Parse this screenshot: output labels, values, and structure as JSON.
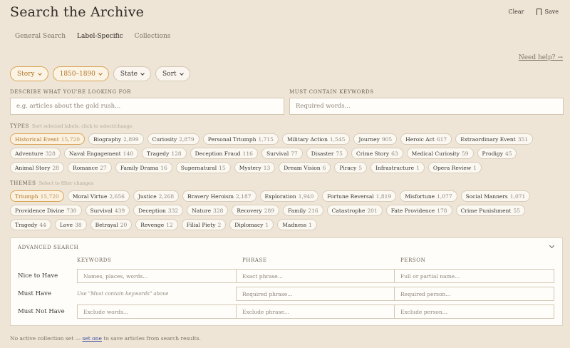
{
  "header": {
    "title": "Search the Archive",
    "clear_label": "Clear",
    "save_label": "Save"
  },
  "tabs": [
    {
      "label": "General Search",
      "active": false
    },
    {
      "label": "Label-Specific",
      "active": true
    },
    {
      "label": "Collections",
      "active": false
    }
  ],
  "help_link": "Need help? →",
  "filters": [
    {
      "label": "Story",
      "selected": true
    },
    {
      "label": "1850–1890",
      "selected": true
    },
    {
      "label": "State",
      "selected": false
    },
    {
      "label": "Sort",
      "selected": false
    }
  ],
  "describe": {
    "label": "DESCRIBE WHAT YOU'RE LOOKING FOR",
    "placeholder": "e.g. articles about the gold rush..."
  },
  "keywords": {
    "label": "MUST CONTAIN KEYWORDS",
    "placeholder": "Required words..."
  },
  "types": {
    "label": "TYPES",
    "hint": "Sort selected labels: click to select/change",
    "items": [
      {
        "name": "Historical Event",
        "count": "15,720",
        "selected": true
      },
      {
        "name": "Biography",
        "count": "2,899"
      },
      {
        "name": "Curiosity",
        "count": "2,879"
      },
      {
        "name": "Personal Triumph",
        "count": "1,715"
      },
      {
        "name": "Military Action",
        "count": "1,545"
      },
      {
        "name": "Journey",
        "count": "905"
      },
      {
        "name": "Heroic Act",
        "count": "617"
      },
      {
        "name": "Extraordinary Event",
        "count": "351"
      },
      {
        "name": "Adventure",
        "count": "328"
      },
      {
        "name": "Naval Engagement",
        "count": "140"
      },
      {
        "name": "Tragedy",
        "count": "128"
      },
      {
        "name": "Deception Fraud",
        "count": "116"
      },
      {
        "name": "Survival",
        "count": "77"
      },
      {
        "name": "Disaster",
        "count": "75"
      },
      {
        "name": "Crime Story",
        "count": "63"
      },
      {
        "name": "Medical Curiosity",
        "count": "59"
      },
      {
        "name": "Prodigy",
        "count": "45"
      },
      {
        "name": "Animal Story",
        "count": "28"
      },
      {
        "name": "Romance",
        "count": "27"
      },
      {
        "name": "Family Drama",
        "count": "16"
      },
      {
        "name": "Supernatural",
        "count": "15"
      },
      {
        "name": "Mystery",
        "count": "13"
      },
      {
        "name": "Dream Vision",
        "count": "6"
      },
      {
        "name": "Piracy",
        "count": "5"
      },
      {
        "name": "Infrastructure",
        "count": "1"
      },
      {
        "name": "Opera Review",
        "count": "1"
      }
    ]
  },
  "themes": {
    "label": "THEMES",
    "hint": "Select to filter changes",
    "items": [
      {
        "name": "Triumph",
        "count": "15,720",
        "selected": true
      },
      {
        "name": "Moral Virtue",
        "count": "2,656"
      },
      {
        "name": "Justice",
        "count": "2,268"
      },
      {
        "name": "Bravery Heroism",
        "count": "2,187"
      },
      {
        "name": "Exploration",
        "count": "1,940"
      },
      {
        "name": "Fortune Reversal",
        "count": "1,819"
      },
      {
        "name": "Misfortune",
        "count": "1,077"
      },
      {
        "name": "Social Manners",
        "count": "1,071"
      },
      {
        "name": "Providence Divine",
        "count": "730"
      },
      {
        "name": "Survival",
        "count": "439"
      },
      {
        "name": "Deception",
        "count": "332"
      },
      {
        "name": "Nature",
        "count": "328"
      },
      {
        "name": "Recovery",
        "count": "289"
      },
      {
        "name": "Family",
        "count": "216"
      },
      {
        "name": "Catastrophe",
        "count": "201"
      },
      {
        "name": "Fate Providence",
        "count": "178"
      },
      {
        "name": "Crime Punishment",
        "count": "55"
      },
      {
        "name": "Tragedy",
        "count": "44"
      },
      {
        "name": "Love",
        "count": "38"
      },
      {
        "name": "Betrayal",
        "count": "20"
      },
      {
        "name": "Revenge",
        "count": "12"
      },
      {
        "name": "Filial Piety",
        "count": "2"
      },
      {
        "name": "Diplomacy",
        "count": "1"
      },
      {
        "name": "Madness",
        "count": "1"
      }
    ]
  },
  "advanced": {
    "title": "ADVANCED SEARCH",
    "columns": [
      "KEYWORDS",
      "PHRASE",
      "PERSON"
    ],
    "rows": [
      {
        "label": "Nice to Have",
        "keywords": "Names, places, words...",
        "phrase": "Exact phrase...",
        "person": "Full or partial name..."
      },
      {
        "label": "Must Have",
        "keywords_note": "Use \"Must contain keywords\" above",
        "phrase": "Required phrase...",
        "person": "Required person..."
      },
      {
        "label": "Must Not Have",
        "keywords": "Exclude words...",
        "phrase": "Exclude phrase...",
        "person": "Exclude person..."
      }
    ]
  },
  "footer": {
    "before": "No active collection set — ",
    "link": "set one",
    "after": " to save articles from search results."
  },
  "colors": {
    "accent": "#d9a558",
    "background": "#efe5d6",
    "link": "#3a4ea0"
  }
}
